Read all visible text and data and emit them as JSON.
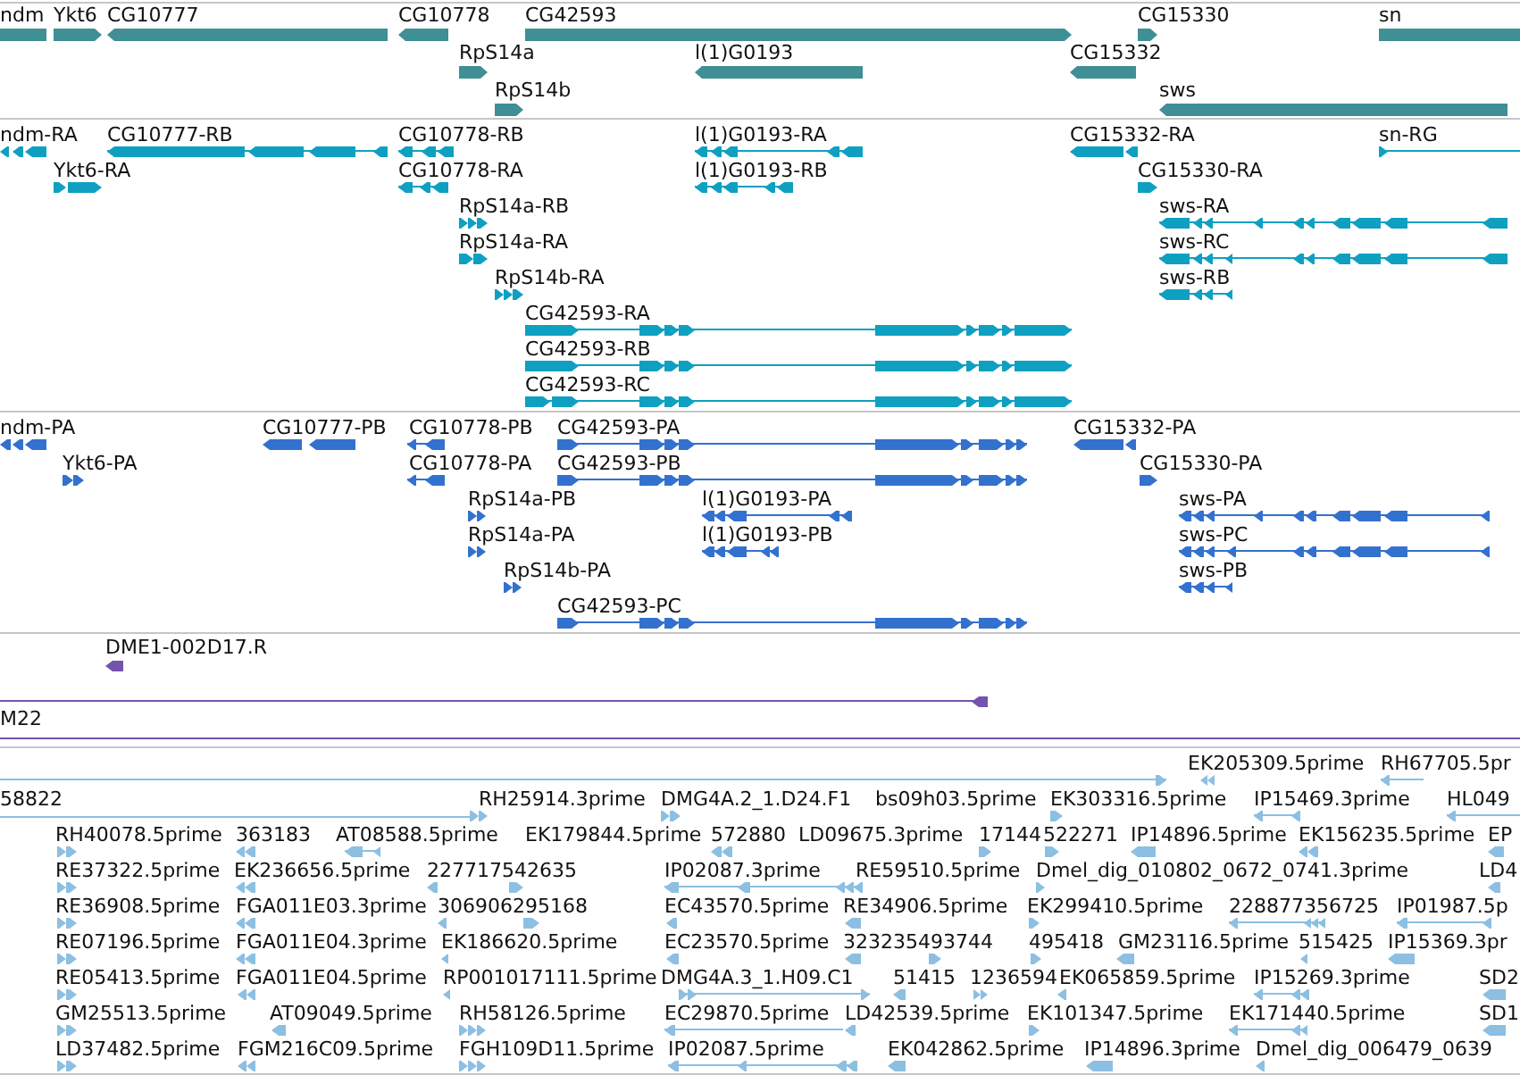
{
  "tracks": [
    {
      "kind": "gene",
      "features": [
        {
          "label": "ndm"
        },
        {
          "label": "Ykt6"
        },
        {
          "label": "CG10777"
        },
        {
          "label": "CG10778"
        },
        {
          "label": "CG42593"
        },
        {
          "label": "CG15330"
        },
        {
          "label": "sn"
        },
        {
          "label": "RpS14a"
        },
        {
          "label": "l(1)G0193"
        },
        {
          "label": "CG15332"
        },
        {
          "label": "RpS14b"
        },
        {
          "label": "sws"
        }
      ]
    },
    {
      "kind": "transcript",
      "features": [
        {
          "label": "ndm-RA"
        },
        {
          "label": "CG10777-RB"
        },
        {
          "label": "CG10778-RB"
        },
        {
          "label": "l(1)G0193-RA"
        },
        {
          "label": "CG15332-RA"
        },
        {
          "label": "sn-RG"
        },
        {
          "label": "Ykt6-RA"
        },
        {
          "label": "CG10778-RA"
        },
        {
          "label": "l(1)G0193-RB"
        },
        {
          "label": "CG15330-RA"
        },
        {
          "label": "RpS14a-RB"
        },
        {
          "label": "sws-RA"
        },
        {
          "label": "RpS14a-RA"
        },
        {
          "label": "sws-RC"
        },
        {
          "label": "RpS14b-RA"
        },
        {
          "label": "sws-RB"
        },
        {
          "label": "CG42593-RA"
        },
        {
          "label": "CG42593-RB"
        },
        {
          "label": "CG42593-RC"
        }
      ]
    },
    {
      "kind": "protein",
      "features": [
        {
          "label": "ndm-PA"
        },
        {
          "label": "CG10777-PB"
        },
        {
          "label": "CG10778-PB"
        },
        {
          "label": "CG42593-PA"
        },
        {
          "label": "CG15332-PA"
        },
        {
          "label": "Ykt6-PA"
        },
        {
          "label": "CG10778-PA"
        },
        {
          "label": "CG42593-PB"
        },
        {
          "label": "CG15330-PA"
        },
        {
          "label": "RpS14a-PB"
        },
        {
          "label": "l(1)G0193-PA"
        },
        {
          "label": "sws-PA"
        },
        {
          "label": "RpS14a-PA"
        },
        {
          "label": "l(1)G0193-PB"
        },
        {
          "label": "sws-PC"
        },
        {
          "label": "RpS14b-PA"
        },
        {
          "label": "sws-PB"
        },
        {
          "label": "CG42593-PC"
        }
      ]
    },
    {
      "kind": "clone",
      "features": [
        {
          "label": "DME1-002D17.R"
        },
        {
          "label": "M22"
        }
      ]
    },
    {
      "kind": "est",
      "features": [
        {
          "label": "EK205309.5prime"
        },
        {
          "label": "RH67705.5pr"
        },
        {
          "label": "58822"
        },
        {
          "label": "RH25914.3prime"
        },
        {
          "label": "DMG4A.2_1.D24.F1"
        },
        {
          "label": "bs09h03.5prime"
        },
        {
          "label": "EK303316.5prime"
        },
        {
          "label": "IP15469.3prime"
        },
        {
          "label": "HL049"
        },
        {
          "label": "RH40078.5prime"
        },
        {
          "label": "363183"
        },
        {
          "label": "AT08588.5prime"
        },
        {
          "label": "EK179844.5prime"
        },
        {
          "label": "572880"
        },
        {
          "label": "LD09675.3prime"
        },
        {
          "label": "17144"
        },
        {
          "label": "522271"
        },
        {
          "label": "IP14896.5prime"
        },
        {
          "label": "EK156235.5prime"
        },
        {
          "label": "EP"
        },
        {
          "label": "RE37322.5prime"
        },
        {
          "label": "EK236656.5prime"
        },
        {
          "label": "227717542635"
        },
        {
          "label": "IP02087.3prime"
        },
        {
          "label": "RE59510.5prime"
        },
        {
          "label": "Dmel_dig_010802_0672_0741.3prime"
        },
        {
          "label": "LD4"
        },
        {
          "label": "RE36908.5prime"
        },
        {
          "label": "FGA011E03.3prime"
        },
        {
          "label": "306906295168"
        },
        {
          "label": "EC43570.5prime"
        },
        {
          "label": "RE34906.5prime"
        },
        {
          "label": "EK299410.5prime"
        },
        {
          "label": "228877356725"
        },
        {
          "label": "IP01987.5p"
        },
        {
          "label": "RE07196.5prime"
        },
        {
          "label": "FGA011E04.3prime"
        },
        {
          "label": "EK186620.5prime"
        },
        {
          "label": "EC23570.5prime"
        },
        {
          "label": "323235493744"
        },
        {
          "label": "495418"
        },
        {
          "label": "GM23116.5prime"
        },
        {
          "label": "515425"
        },
        {
          "label": "IP15369.3pr"
        },
        {
          "label": "RE05413.5prime"
        },
        {
          "label": "FGA011E04.5prime"
        },
        {
          "label": "RP001017111.5prime"
        },
        {
          "label": "DMG4A.3_1.H09.C1"
        },
        {
          "label": "51415"
        },
        {
          "label": "1236594"
        },
        {
          "label": "EK065859.5prime"
        },
        {
          "label": "IP15269.3prime"
        },
        {
          "label": "SD2"
        },
        {
          "label": "GM25513.5prime"
        },
        {
          "label": "AT09049.5prime"
        },
        {
          "label": "RH58126.5prime"
        },
        {
          "label": "EC29870.5prime"
        },
        {
          "label": "LD42539.5prime"
        },
        {
          "label": "EK101347.5prime"
        },
        {
          "label": "EK171440.5prime"
        },
        {
          "label": "SD1"
        },
        {
          "label": "LD37482.5prime"
        },
        {
          "label": "FGM216C09.5prime"
        },
        {
          "label": "FGH109D11.5prime"
        },
        {
          "label": "IP02087.5prime"
        },
        {
          "label": "EK042862.5prime"
        },
        {
          "label": "IP14896.3prime"
        },
        {
          "label": "Dmel_dig_006479_0639"
        }
      ]
    }
  ]
}
